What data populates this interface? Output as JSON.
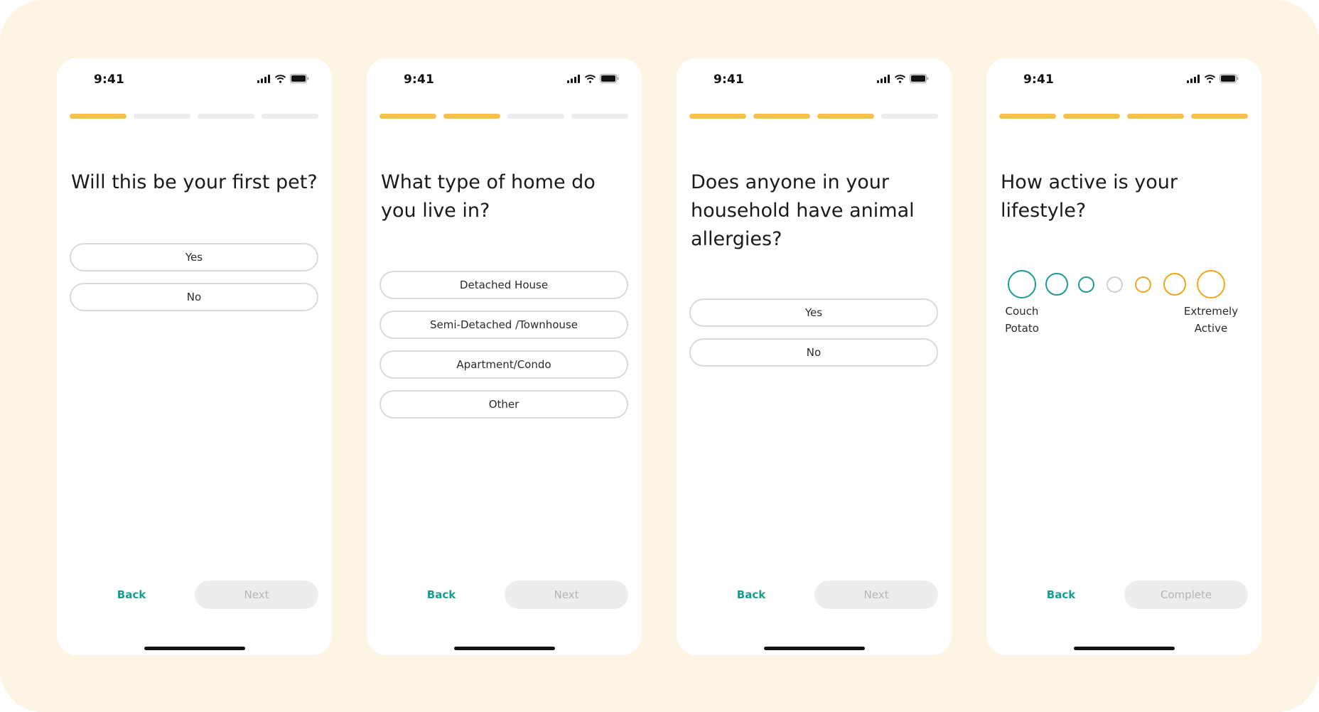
{
  "colors": {
    "background": "#fdf4e4",
    "accent_teal": "#1a9c8f",
    "accent_orange": "#f2a51a",
    "progress_active": "#f7c04d",
    "progress_inactive": "#ececec"
  },
  "screens": [
    {
      "time": "9:41",
      "progress": {
        "step": 1,
        "total": 4
      },
      "question": "Will this be your first pet?",
      "options": [
        "Yes",
        "No"
      ],
      "back_label": "Back",
      "next_label": "Next"
    },
    {
      "time": "9:41",
      "progress": {
        "step": 2,
        "total": 4
      },
      "question": "What type of home do you live in?",
      "options": [
        "Detached House",
        "Semi-Detached /Townhouse",
        "Apartment/Condo",
        "Other"
      ],
      "back_label": "Back",
      "next_label": "Next"
    },
    {
      "time": "9:41",
      "progress": {
        "step": 3,
        "total": 4
      },
      "question": "Does anyone in your household have animal allergies?",
      "options": [
        "Yes",
        "No"
      ],
      "back_label": "Back",
      "next_label": "Next"
    },
    {
      "time": "9:41",
      "progress": {
        "step": 4,
        "total": 4
      },
      "question": "How active is your lifestyle?",
      "scale": {
        "points": 7,
        "left_label_line1": "Couch",
        "left_label_line2": "Potato",
        "right_label_line1": "Extremely",
        "right_label_line2": "Active"
      },
      "back_label": "Back",
      "next_label": "Complete"
    }
  ],
  "icons": [
    "signal-icon",
    "wifi-icon",
    "battery-icon"
  ]
}
